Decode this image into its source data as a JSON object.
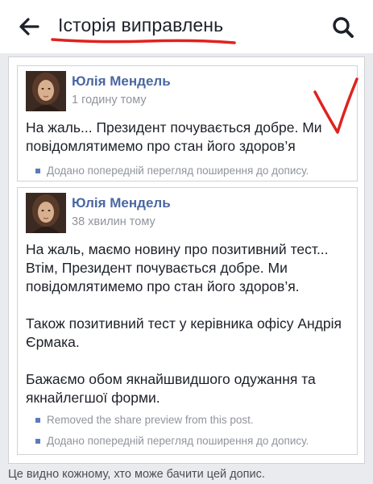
{
  "header": {
    "title": "Історія виправлень",
    "back_icon": "arrow-left-icon",
    "search_icon": "search-icon"
  },
  "posts": [
    {
      "author": "Юлія Мендель",
      "time": "1 годину тому",
      "lines": [
        "На жаль... Президент почувається добре. Ми",
        "повідомлятимемо про стан його здоров’я"
      ],
      "changes": [
        "Додано попередній перегляд поширення до допису."
      ]
    },
    {
      "author": "Юлія Мендель",
      "time": "38 хвилин тому",
      "lines": [
        "На жаль, маємо новину про позитивний тест...",
        "Втім, Президент почувається добре. Ми",
        "повідомлятимемо про стан його здоров’я.",
        "Також позитивний тест у керівника офісу Андрія",
        "Єрмака.",
        "Бажаємо обом якнайшвидшого одужання та",
        "якнайлегшої форми."
      ],
      "changes": [
        "Removed the share preview from this post.",
        "Додано попередній перегляд поширення до допису."
      ]
    }
  ],
  "footer": {
    "visibility_note": "Це видно кожному, хто може бачити цей допис."
  },
  "colors": {
    "author_link": "#4b67a1",
    "meta_gray": "#90949c",
    "annotation_red": "#e0221e",
    "bullet_blue": "#5b7bbb"
  }
}
